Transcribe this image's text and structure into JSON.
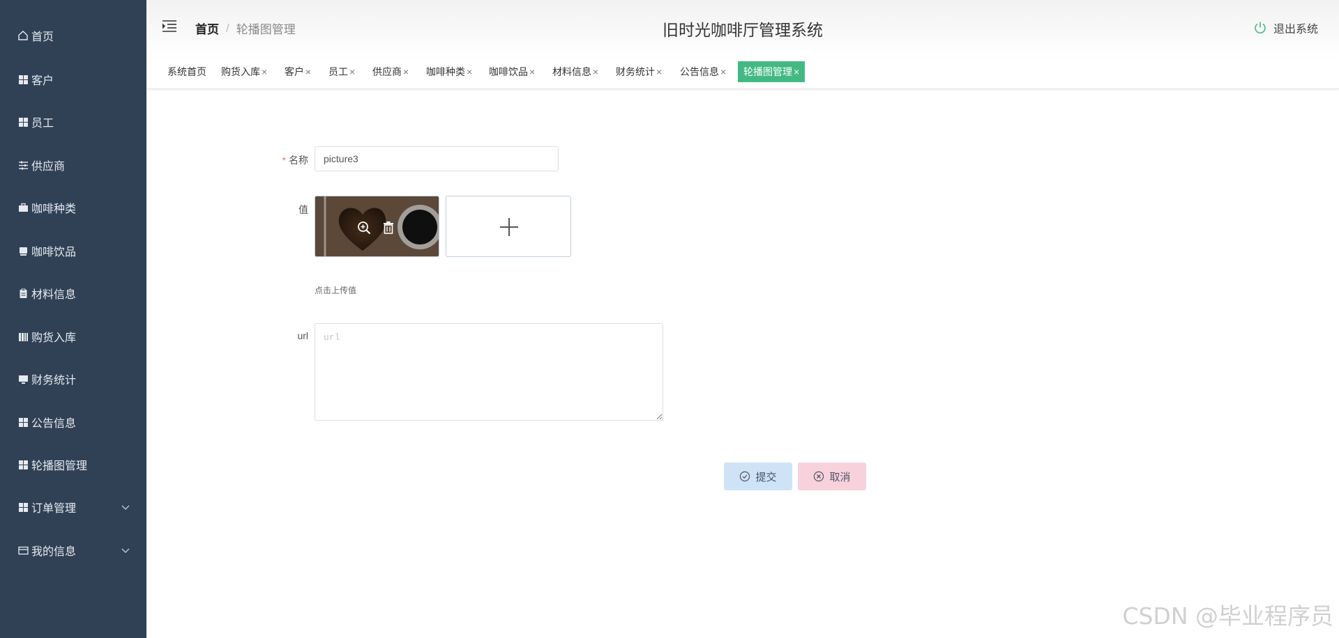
{
  "sidebar": {
    "items": [
      {
        "label": "首页",
        "icon": "home-icon"
      },
      {
        "label": "客户",
        "icon": "grid-icon"
      },
      {
        "label": "员工",
        "icon": "grid-icon"
      },
      {
        "label": "供应商",
        "icon": "sliders-icon"
      },
      {
        "label": "咖啡种类",
        "icon": "briefcase-icon"
      },
      {
        "label": "咖啡饮品",
        "icon": "drive-icon"
      },
      {
        "label": "材料信息",
        "icon": "clipboard-icon"
      },
      {
        "label": "购货入库",
        "icon": "bars-icon"
      },
      {
        "label": "财务统计",
        "icon": "monitor-icon"
      },
      {
        "label": "公告信息",
        "icon": "grid-icon"
      },
      {
        "label": "轮播图管理",
        "icon": "grid-icon"
      },
      {
        "label": "订单管理",
        "icon": "grid-icon"
      },
      {
        "label": "我的信息",
        "icon": "card-icon"
      }
    ],
    "bg_color": "#304156"
  },
  "header": {
    "breadcrumb_home": "首页",
    "breadcrumb_sep": "/",
    "breadcrumb_current": "轮播图管理",
    "title": "旧时光咖啡厅管理系统",
    "logout": "退出系统"
  },
  "tags": {
    "items": [
      "系统首页",
      "购货入库",
      "客户",
      "员工",
      "供应商",
      "咖啡种类",
      "咖啡饮品",
      "材料信息",
      "财务统计",
      "公告信息",
      "轮播图管理"
    ],
    "close_glyph": "×",
    "active_color": "#42b983"
  },
  "form": {
    "name_required": "*",
    "name_label": "名称",
    "name_value": "picture3",
    "value_label": "值",
    "upload_hint": "点击上传值",
    "url_label": "url",
    "url_placeholder": "url",
    "submit": "提交",
    "cancel": "取消"
  },
  "watermark": "CSDN @毕业程序员"
}
